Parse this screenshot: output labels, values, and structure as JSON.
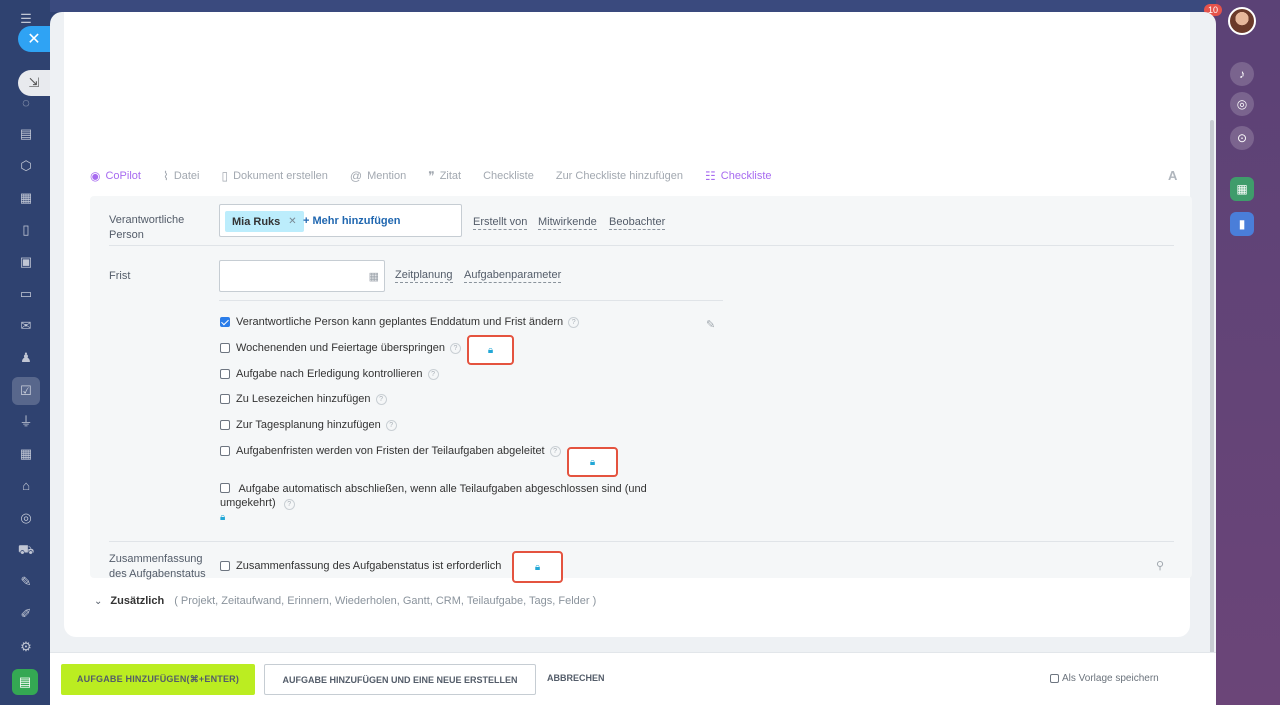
{
  "toolbar": {
    "copilot": "CoPilot",
    "file": "Datei",
    "create_doc": "Dokument erstellen",
    "mention": "Mention",
    "quote": "Zitat",
    "checklist": "Checkliste",
    "add_to_checklist": "Zur Checkliste hinzufügen",
    "checklist_purple": "Checkliste",
    "font": "A"
  },
  "responsible": {
    "label": "Verantwortliche Person",
    "person": "Mia Ruks",
    "add_more": "+ Mehr hinzufügen",
    "created_by": "Erstellt von",
    "participants": "Mitwirkende",
    "observers": "Beobachter"
  },
  "deadline": {
    "label": "Frist",
    "date_value": "",
    "planning": "Zeitplanung",
    "params": "Aufgabenparameter"
  },
  "options": [
    {
      "label": "Verantwortliche Person kann geplantes Enddatum und Frist ändern",
      "checked": true
    },
    {
      "label": "Wochenenden und Feiertage überspringen",
      "checked": false
    },
    {
      "label": "Aufgabe nach Erledigung kontrollieren",
      "checked": false
    },
    {
      "label": "Zu Lesezeichen hinzufügen",
      "checked": false
    },
    {
      "label": "Zur Tagesplanung hinzufügen",
      "checked": false
    },
    {
      "label": "Aufgabenfristen werden von Fristen der Teilaufgaben abgeleitet",
      "checked": false
    },
    {
      "label": "Aufgabe automatisch abschließen, wenn alle Teilaufgaben abgeschlossen sind (und umgekehrt)",
      "checked": false
    }
  ],
  "summary": {
    "label": "Zusammenfassung des Aufgabenstatus",
    "option": "Zusammenfassung des Aufgabenstatus ist erforderlich"
  },
  "extra": {
    "title": "Zusätzlich",
    "items": "( Projekt,  Zeitaufwand,  Erinnern,  Wiederholen,  Gantt,  CRM,  Teilaufgabe,  Tags,  Felder )"
  },
  "footer": {
    "add_task": "AUFGABE HINZUFÜGEN(⌘+ENTER)",
    "add_and_new": "AUFGABE HINZUFÜGEN UND EINE NEUE ERSTELLEN",
    "cancel": "ABBRECHEN",
    "save_template": "Als Vorlage speichern"
  },
  "notifications_count": "10",
  "colors": {
    "accent_green": "#bbed21",
    "link_blue": "#2067b0",
    "highlight_red": "#e4533f",
    "lock_blue": "#22a7d6",
    "copilot_purple": "#a76bf0"
  }
}
